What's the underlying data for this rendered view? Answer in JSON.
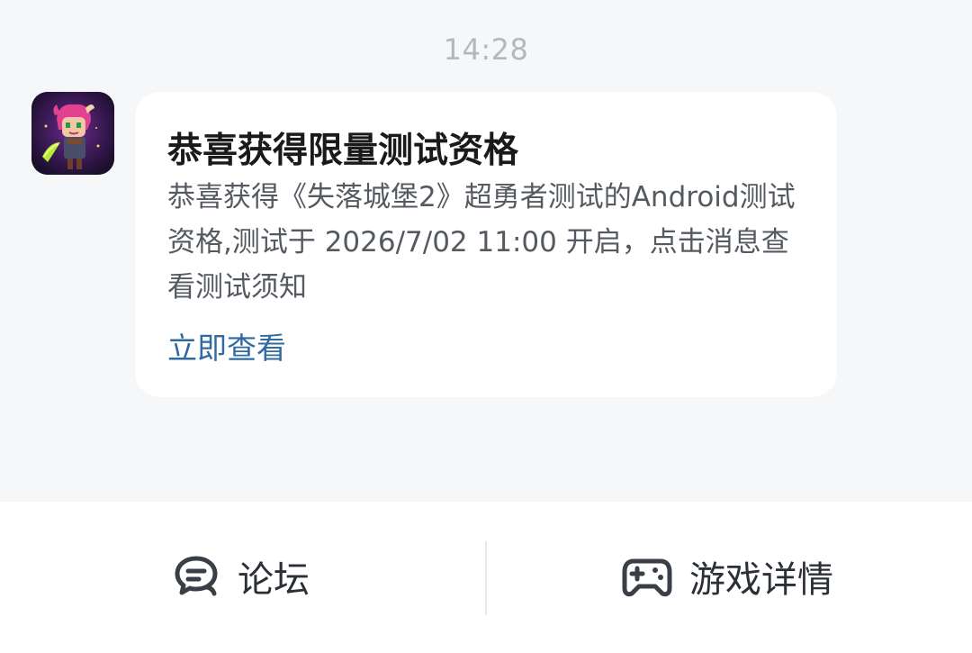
{
  "chat": {
    "timestamp": "14:28",
    "message": {
      "title": "恭喜获得限量测试资格",
      "body": "恭喜获得《失落城堡2》超勇者测试的Android测试资格,测试于 2026/7/02 11:00 开启，点击消息查看测试须知",
      "link_label": "立即查看"
    },
    "avatar_icon": "game-character-avatar"
  },
  "bottom_bar": {
    "forum_label": "论坛",
    "forum_icon": "chat-bubble-icon",
    "game_label": "游戏详情",
    "game_icon": "gamepad-icon"
  },
  "colors": {
    "background": "#f6f7f9",
    "card": "#ffffff",
    "link": "#2f6aa3",
    "timestamp": "#b3b8c0"
  }
}
